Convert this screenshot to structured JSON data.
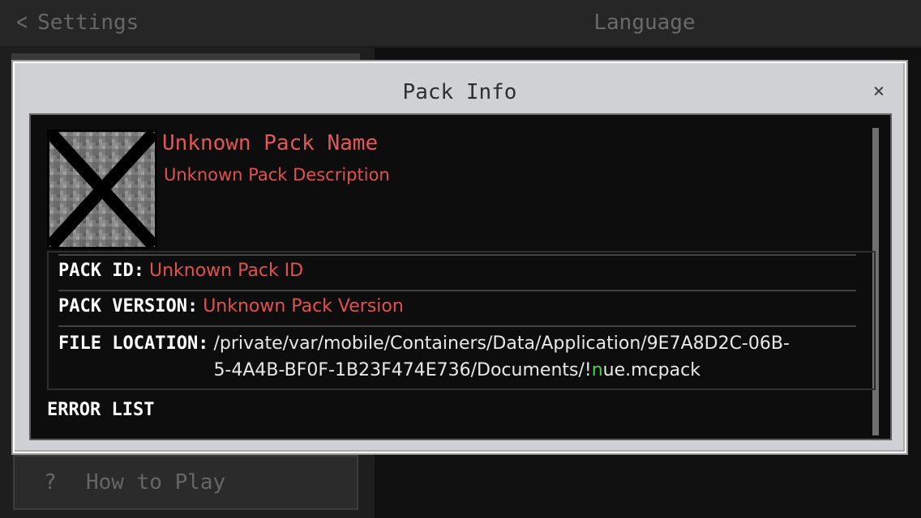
{
  "background": {
    "back_label": "Settings",
    "title": "Language",
    "howto_icon": "?",
    "howto_label": "How to Play"
  },
  "dialog": {
    "title": "Pack Info",
    "close_glyph": "×",
    "pack": {
      "name": "Unknown Pack Name",
      "description": "Unknown Pack Description",
      "icon": "missing-texture-icon"
    },
    "details": {
      "id_label": "PACK ID:",
      "id_value": "Unknown Pack ID",
      "version_label": "PACK VERSION:",
      "version_value": "Unknown Pack Version",
      "location_label": "FILE LOCATION:",
      "location_line1": "/private/var/mobile/Containers/Data/Application/9E7A8D2C-06B-",
      "location_line2_pre": "5-4A4B-BF0F-1B23F474E736/Documents/!",
      "location_line2_hl": "n",
      "location_line2_post": "ue.mcpack"
    },
    "error_list_label": "ERROR LIST"
  },
  "colors": {
    "error_red": "#e05252",
    "highlight_green": "#4bd24b",
    "dialog_bg": "#d0d1d4",
    "content_bg": "#0d0d0d"
  }
}
